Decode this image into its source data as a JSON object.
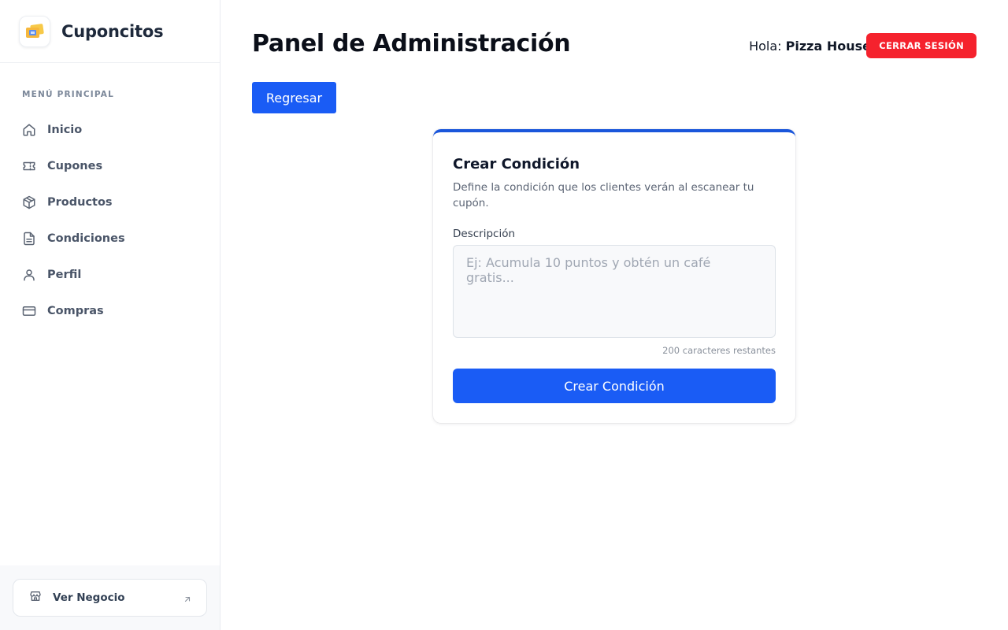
{
  "app": {
    "name": "Cuponcitos"
  },
  "sidebar": {
    "menu_heading": "MENÚ PRINCIPAL",
    "items": [
      {
        "label": "Inicio",
        "icon": "home-icon"
      },
      {
        "label": "Cupones",
        "icon": "ticket-icon"
      },
      {
        "label": "Productos",
        "icon": "package-icon"
      },
      {
        "label": "Condiciones",
        "icon": "document-icon"
      },
      {
        "label": "Perfil",
        "icon": "user-icon"
      },
      {
        "label": "Compras",
        "icon": "credit-card-icon"
      }
    ],
    "footer": {
      "label": "Ver Negocio",
      "icon": "store-icon",
      "arrow_icon": "arrow-up-right-icon"
    }
  },
  "header": {
    "title": "Panel de Administración",
    "greeting_prefix": "Hola:",
    "user_name": "Pizza House",
    "logout_label": "CERRAR SESIÓN"
  },
  "back_button": {
    "label": "Regresar"
  },
  "form": {
    "title": "Crear Condición",
    "description": "Define la condición que los clientes verán al escanear tu cupón.",
    "field_label": "Descripción",
    "placeholder": "Ej: Acumula 10 puntos y obtén un café gratis...",
    "value": "",
    "char_count": "200 caracteres restantes",
    "submit_label": "Crear Condición"
  },
  "colors": {
    "primary": "#1a5cf5",
    "card_accent": "#1a56db",
    "danger": "#f5222d",
    "sidebar_text": "#4a5568"
  }
}
